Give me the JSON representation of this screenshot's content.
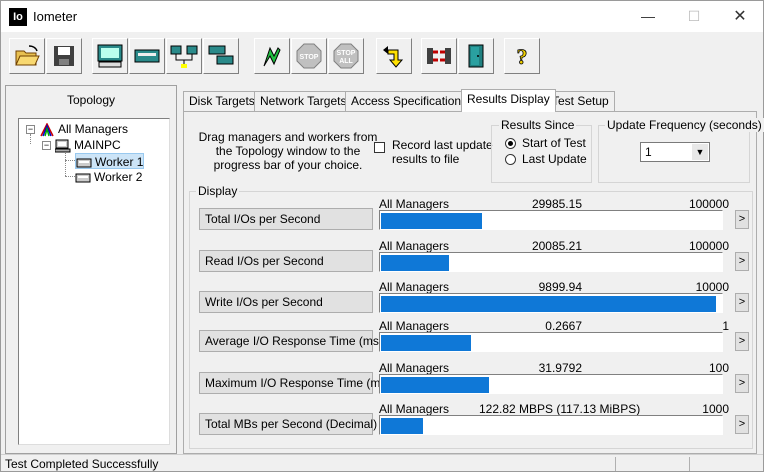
{
  "window": {
    "icon_text": "Io",
    "title": "Iometer"
  },
  "toolbar": {
    "buttons": [
      "open-config-icon",
      "save-config-icon",
      "new-disk-worker-icon",
      "new-network-worker-icon",
      "duplicate-worker-icon",
      "start-tests-icon",
      "stop-icon",
      "stop-all-icon",
      "reset-workers-icon",
      "disconnect-managers-icon",
      "exit-icon",
      "about-icon"
    ],
    "stop_label": "STOP",
    "stop_all_line1": "STOP",
    "stop_all_line2": "ALL",
    "about_glyph": "?"
  },
  "topology": {
    "title": "Topology",
    "items": [
      {
        "label": "All Managers"
      },
      {
        "label": "MAINPC"
      },
      {
        "label": "Worker 1"
      },
      {
        "label": "Worker 2"
      }
    ]
  },
  "tabs": [
    {
      "label": "Disk Targets"
    },
    {
      "label": "Network Targets"
    },
    {
      "label": "Access Specifications"
    },
    {
      "label": "Results Display"
    },
    {
      "label": "Test Setup"
    }
  ],
  "results": {
    "drag_text": "Drag managers and workers from the Topology window to the progress bar of your choice.",
    "record_label": "Record last update results to file",
    "results_since_title": "Results Since",
    "start_of_test": "Start of Test",
    "last_update": "Last Update",
    "update_freq_title": "Update Frequency (seconds)",
    "update_freq_value": "1",
    "display_title": "Display"
  },
  "metrics": [
    {
      "button": "Total I/Os per Second",
      "source": "All Managers",
      "value": "29985.15",
      "max": "100000",
      "fill": 0.3
    },
    {
      "button": "Read I/Os per Second",
      "source": "All Managers",
      "value": "20085.21",
      "max": "100000",
      "fill": 0.2
    },
    {
      "button": "Write I/Os per Second",
      "source": "All Managers",
      "value": "9899.94",
      "max": "10000",
      "fill": 0.99
    },
    {
      "button": "Average I/O Response Time (ms)",
      "source": "All Managers",
      "value": "0.2667",
      "max": "1",
      "fill": 0.2667
    },
    {
      "button": "Maximum I/O Response Time (ms)",
      "source": "All Managers",
      "value": "31.9792",
      "max": "100",
      "fill": 0.32
    },
    {
      "button": "Total MBs per Second (Decimal)",
      "source": "All Managers",
      "value": "122.82 MBPS (117.13 MiBPS)",
      "max": "1000",
      "fill": 0.123
    }
  ],
  "arrow_glyph": ">",
  "status": {
    "text": "Test Completed Successfully"
  },
  "colors": {
    "bar": "#0f78d7"
  }
}
